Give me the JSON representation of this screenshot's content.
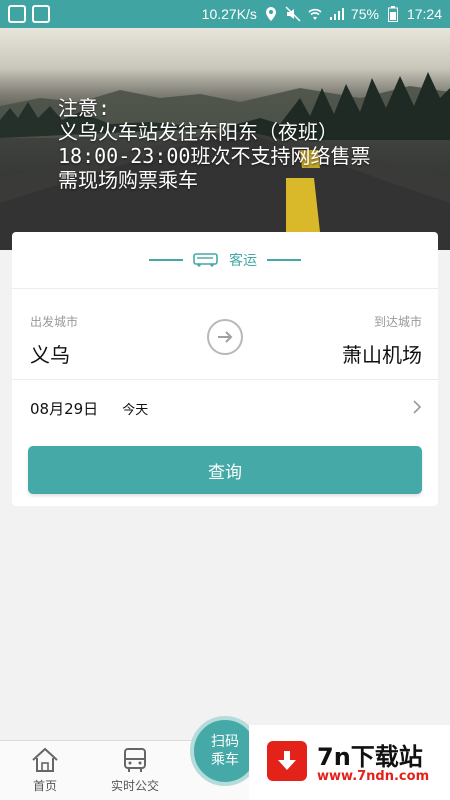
{
  "status_bar": {
    "net_speed": "10.27K/s",
    "battery": "75%",
    "time": "17:24"
  },
  "banner": {
    "notice_lines": [
      "注意:",
      "义乌火车站发往东阳东（夜班）",
      "18:00-23:00班次不支持网络售票",
      "需现场购票乘车"
    ]
  },
  "search": {
    "mode_label": "客运",
    "from_label": "出发城市",
    "from_city": "义乌",
    "to_label": "到达城市",
    "to_city": "萧山机场",
    "date": "08月29日",
    "day": "今天",
    "query_button": "查询"
  },
  "bottom_nav": {
    "items": [
      {
        "label": "首页",
        "icon": "home-icon"
      },
      {
        "label": "实时公交",
        "icon": "bus-icon"
      }
    ],
    "scan_line1": "扫码",
    "scan_line2": "乘车"
  },
  "watermark": {
    "title": "7n下载站",
    "url": "www.7ndn.com"
  },
  "colors": {
    "accent": "#45aaa7",
    "status_bar": "#3fa4a2",
    "watermark_red": "#e32219"
  }
}
